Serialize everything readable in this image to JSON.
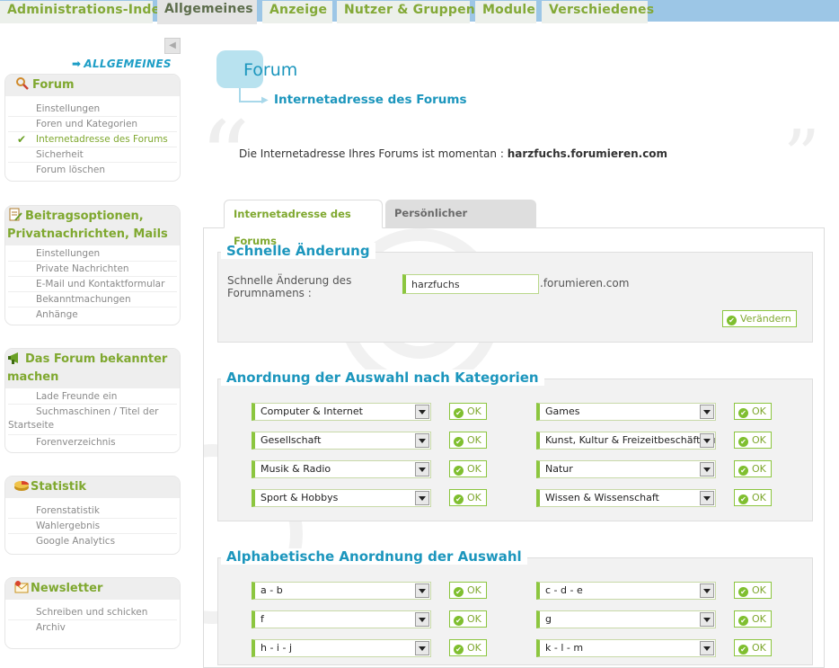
{
  "topnav": {
    "tabs": [
      {
        "label": "Administrations-Index"
      },
      {
        "label": "Allgemeines"
      },
      {
        "label": "Anzeige"
      },
      {
        "label": "Nutzer & Gruppen"
      },
      {
        "label": "Module"
      },
      {
        "label": "Verschiedenes"
      }
    ],
    "active_index": 1
  },
  "sidebar": {
    "heading": "ALLGEMEINES",
    "sections": [
      {
        "title": "Forum",
        "icon": "magnifier-tools-icon",
        "items": [
          "Einstellungen",
          "Foren und Kategorien",
          "Internetadresse des Forums",
          "Sicherheit",
          "Forum löschen"
        ],
        "active_item": 2
      },
      {
        "title": "Beitragsoptionen, Privatnachrichten, Mails",
        "icon": "document-edit-icon",
        "items": [
          "Einstellungen",
          "Private Nachrichten",
          "E-Mail und Kontaktformular",
          "Bekanntmachungen",
          "Anhänge"
        ]
      },
      {
        "title": "Das Forum bekannter machen",
        "icon": "megaphone-icon",
        "items": [
          "Lade Freunde ein",
          "Suchmaschinen / Titel der Startseite",
          "Forenverzeichnis"
        ]
      },
      {
        "title": "Statistik",
        "icon": "pie-chart-icon",
        "items": [
          "Forenstatistik",
          "Wahlergebnis",
          "Google Analytics"
        ]
      },
      {
        "title": "Newsletter",
        "icon": "envelope-icon",
        "items": [
          "Schreiben und schicken",
          "Archiv"
        ]
      }
    ]
  },
  "main": {
    "title": "Forum",
    "subtitle": "Internetadresse des Forums",
    "info_prefix": "Die Internetadresse Ihres Forums ist momentan :",
    "info_url": "harzfuchs.forumieren.com",
    "tabs": [
      {
        "label": "Internetadresse des Forums"
      },
      {
        "label": "Persönlicher Domainname"
      }
    ],
    "quick_change": {
      "title": "Schnelle Änderung",
      "label": "Schnelle Änderung des Forumnamens :",
      "value": "harzfuchs",
      "suffix": ".forumieren.com",
      "button": "Verändern"
    },
    "categories": {
      "title": "Anordnung der Auswahl nach Kategorien",
      "selects": [
        "Computer & Internet",
        "Games",
        "Gesellschaft",
        "Kunst, Kultur & Freizeitbeschäftigung",
        "Musik & Radio",
        "Natur",
        "Sport & Hobbys",
        "Wissen & Wissenschaft"
      ],
      "button": "OK"
    },
    "alphabetical": {
      "title": "Alphabetische Anordnung der Auswahl",
      "selects": [
        "a - b",
        "c - d - e",
        "f",
        "g",
        "h - i - j",
        "k - l - m"
      ],
      "button": "OK"
    }
  },
  "colors": {
    "accent_green": "#7fa82f",
    "accent_blue": "#1c96bd",
    "nav_bg": "#9cc6e6"
  }
}
